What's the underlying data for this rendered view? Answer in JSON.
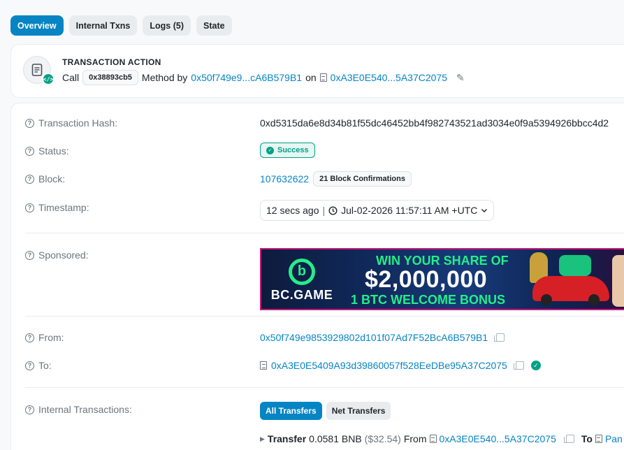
{
  "tabs": [
    {
      "label": "Overview",
      "active": true
    },
    {
      "label": "Internal Txns",
      "active": false
    },
    {
      "label": "Logs (5)",
      "active": false
    },
    {
      "label": "State",
      "active": false
    }
  ],
  "action": {
    "title": "TRANSACTION ACTION",
    "call_label": "Call",
    "method_id": "0x38893cb5",
    "method_by_label": "Method by",
    "from_short": "0x50f749e9...cA6B579B1",
    "on_label": "on",
    "to_short": "0xA3E0E540...5A37C2075"
  },
  "rows": {
    "tx_hash": {
      "label": "Transaction Hash:",
      "value": "0xd5315da6e8d34b81f55dc46452bb4f982743521ad3034e0f9a5394926bbcc4d2"
    },
    "status": {
      "label": "Status:",
      "value": "Success"
    },
    "block": {
      "label": "Block:",
      "value": "107632622",
      "confirmations": "21 Block Confirmations"
    },
    "timestamp": {
      "label": "Timestamp:",
      "relative": "12 secs ago",
      "absolute": "Jul-02-2026 11:57:11 AM +UTC"
    },
    "sponsored": {
      "label": "Sponsored:"
    },
    "from": {
      "label": "From:",
      "value": "0x50f749e9853929802d101f07Ad7F52BcA6B579B1"
    },
    "to": {
      "label": "To:",
      "value": "0xA3E0E5409A93d39860057f528EeDBe95A37C2075"
    },
    "internal": {
      "label": "Internal Transactions:",
      "btn_all": "All Transfers",
      "btn_net": "Net Transfers",
      "transfer_label": "Transfer",
      "transfer_amount": "0.0581 BNB",
      "transfer_usd": "($32.54)",
      "from_label": "From",
      "from_short": "0xA3E0E540...5A37C2075",
      "to_label": "To",
      "to_partial": "Pan"
    }
  },
  "banner": {
    "logo_text": "BC.GAME",
    "line1": "WIN YOUR SHARE OF",
    "line2": "$2,000,000",
    "line3": "1 BTC WELCOME BONUS"
  }
}
